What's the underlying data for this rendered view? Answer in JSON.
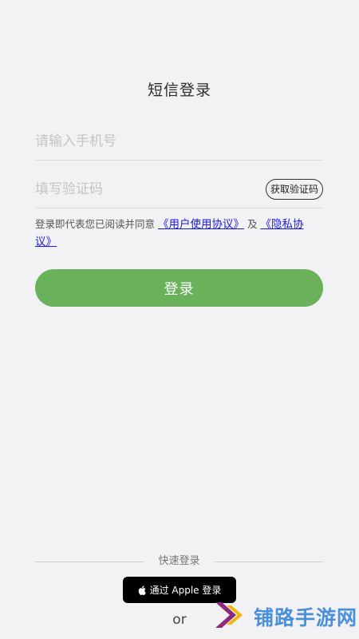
{
  "page": {
    "title": "短信登录"
  },
  "form": {
    "phone_placeholder": "请输入手机号",
    "code_placeholder": "填写验证码",
    "get_code_label": "获取验证码",
    "agreement_prefix": "登录即代表您已阅读并同意",
    "user_agreement_link": "《用户使用协议》",
    "agreement_and": "及",
    "privacy_link": "《隐私协议》",
    "login_label": "登录"
  },
  "quick_login": {
    "label": "快速登录",
    "apple_label": "通过 Apple 登录",
    "or_text": "or"
  },
  "watermark": {
    "text": "铺路手游网"
  },
  "colors": {
    "background": "#f2f2f4",
    "login_button": "#6ab15c",
    "link": "#1a1ae6",
    "apple_button": "#000000",
    "watermark_text": "#4a90d9",
    "watermark_logo_purple": "#8e2a7e",
    "watermark_logo_yellow": "#f2b705"
  }
}
